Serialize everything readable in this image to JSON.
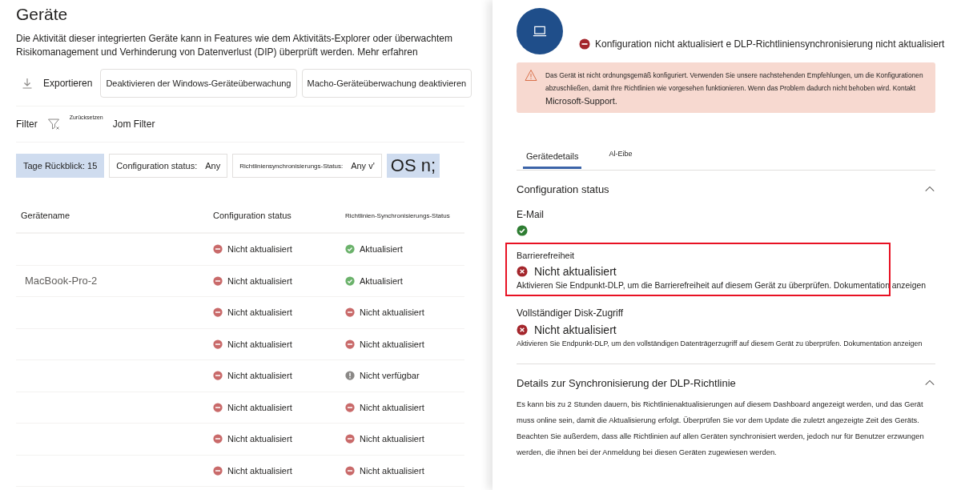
{
  "page": {
    "title": "Geräte",
    "description": "Die Aktivität dieser integrierten Geräte kann in Features wie dem Aktivitäts-Explorer oder überwachtem Risikomanagement und Verhinderung von Datenverlust (DIP) überprüft werden.",
    "learn_more": "Mehr erfahren"
  },
  "toolbar": {
    "export": "Exportieren",
    "buttons": [
      "Deaktivieren der Windows-Geräteüberwachung",
      "Macho-Geräteüberwachung deaktivieren"
    ]
  },
  "filter_bar": {
    "label": "Filter",
    "reset": "Zurücksetzen",
    "text": "Jom Filter"
  },
  "filters": [
    {
      "label": "Tage Rückblick: 15",
      "selected": true
    },
    {
      "label": "Configuration status:",
      "value": "Any",
      "selected": false
    },
    {
      "label": "Richtliniensynchronisierungs-Status:",
      "value": "Any v'",
      "selected": false
    },
    {
      "label": "OS n;",
      "selected": true
    }
  ],
  "table": {
    "columns": [
      "Gerätename",
      "Configuration status",
      "Richtlinien-Synchronisierungs-Status"
    ],
    "rows": [
      {
        "config": {
          "kind": "error",
          "text": "Nicht aktualisiert"
        },
        "sync": {
          "kind": "ok",
          "text": "Aktualisiert"
        }
      },
      {
        "device": "MacBook-Pro-2",
        "config": {
          "kind": "error",
          "text": "Nicht aktualisiert"
        },
        "sync": {
          "kind": "ok",
          "text": "Aktualisiert"
        }
      },
      {
        "config": {
          "kind": "error",
          "text": "Nicht aktualisiert"
        },
        "sync": {
          "kind": "error",
          "text": "Nicht aktualisiert"
        }
      },
      {
        "config": {
          "kind": "error",
          "text": "Nicht aktualisiert"
        },
        "sync": {
          "kind": "error",
          "text": "Nicht aktualisiert"
        }
      },
      {
        "config": {
          "kind": "error",
          "text": "Nicht aktualisiert"
        },
        "sync": {
          "kind": "unavailable",
          "text": "Nicht verfügbar"
        }
      },
      {
        "config": {
          "kind": "error",
          "text": "Nicht aktualisiert"
        },
        "sync": {
          "kind": "error",
          "text": "Nicht aktualisiert"
        }
      },
      {
        "config": {
          "kind": "error",
          "text": "Nicht aktualisiert"
        },
        "sync": {
          "kind": "error",
          "text": "Nicht aktualisiert"
        }
      },
      {
        "config": {
          "kind": "error",
          "text": "Nicht aktualisiert"
        },
        "sync": {
          "kind": "error",
          "text": "Nicht aktualisiert"
        }
      }
    ]
  },
  "panel": {
    "status_text": "Konfiguration nicht aktualisiert e DLP-Richtliniensynchronisierung nicht aktualisiert",
    "warning": {
      "text": "Das Gerät ist nicht ordnungsgemäß konfiguriert. Verwenden Sie unsere nachstehenden Empfehlungen, um die Konfigurationen abzuschließen, damit Ihre Richtlinien wie vorgesehen funktionieren. Wenn das Problem dadurch nicht behoben wird. Kontakt",
      "link": "Microsoft-Support."
    },
    "tabs": [
      {
        "label": "Gerätedetails",
        "selected": true
      },
      {
        "label": "Al-Eibe",
        "selected": false
      }
    ],
    "sections": [
      {
        "title": "Configuration status",
        "expanded": true,
        "items": [
          {
            "name": "E-Mail",
            "kind": "ok",
            "highlighted": false
          },
          {
            "name": "Barrierefreiheit",
            "kind": "error",
            "status_text": "Nicht aktualisiert",
            "description": "Aktivieren Sie Endpunkt-DLP, um die Barrierefreiheit auf diesem Gerät zu überprüfen.",
            "link": "Dokumentation anzeigen",
            "highlighted": true
          },
          {
            "name": "Vollständiger Disk-Zugriff",
            "kind": "error",
            "status_text": "Nicht aktualisiert",
            "description": "Aktivieren Sie Endpunkt-DLP, um den vollständigen Datenträgerzugriff auf diesem Gerät zu überprüfen.",
            "link": "Dokumentation anzeigen",
            "highlighted": false
          }
        ]
      },
      {
        "title": "Details zur Synchronisierung der DLP-Richtlinie",
        "expanded": true,
        "text": "Es kann bis zu 2 Stunden dauern, bis Richtlinienaktualisierungen auf diesem Dashboard angezeigt werden, und das Gerät muss online sein, damit die Aktualisierung erfolgt. Überprüfen Sie vor dem Update die zuletzt angezeigte Zeit des Geräts. Beachten Sie außerdem, dass alle Richtlinien auf allen Geräten synchronisiert werden, jedoch nur für Benutzer erzwungen werden, die ihnen bei der Anmeldung bei diesen Geräten zugewiesen werden."
      }
    ]
  }
}
